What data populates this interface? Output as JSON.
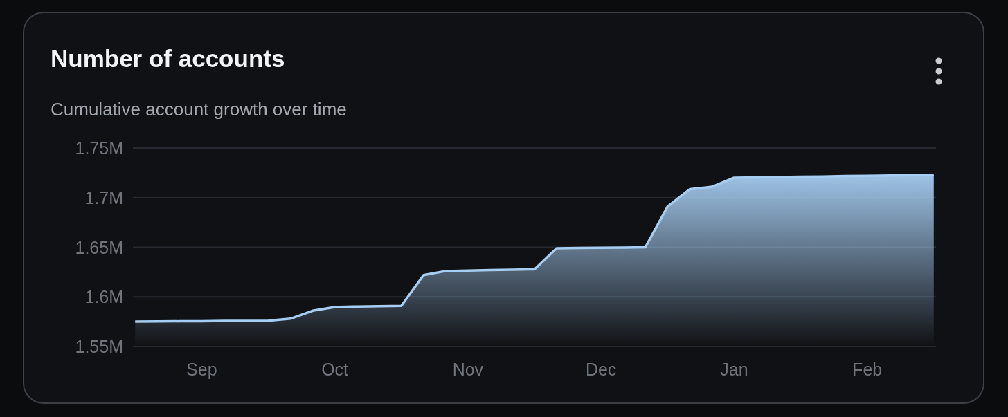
{
  "card": {
    "title": "Number of accounts",
    "subtitle": "Cumulative account growth over time",
    "chart_data": {
      "type": "area",
      "categories": [
        null,
        null,
        null,
        "Sep",
        null,
        null,
        null,
        null,
        null,
        "Oct",
        null,
        null,
        null,
        null,
        null,
        "Nov",
        null,
        null,
        null,
        null,
        null,
        "Dec",
        null,
        null,
        null,
        null,
        null,
        "Jan",
        null,
        null,
        null,
        null,
        null,
        "Feb",
        null,
        null,
        null
      ],
      "series": [
        {
          "color": "#a6cdf2",
          "values": [
            1.575,
            1.5752,
            1.5754,
            1.5755,
            1.5757,
            1.5758,
            1.576,
            1.578,
            1.586,
            1.5898,
            1.5903,
            1.5906,
            1.591,
            1.622,
            1.626,
            1.6265,
            1.627,
            1.6274,
            1.6278,
            1.649,
            1.6493,
            1.6495,
            1.6497,
            1.65,
            1.691,
            1.7085,
            1.711,
            1.7201,
            1.7204,
            1.7207,
            1.721,
            1.7213,
            1.7217,
            1.722,
            1.7223,
            1.7226,
            1.7229
          ]
        }
      ],
      "grid": true,
      "ylim": [
        1.55,
        1.75
      ],
      "yticks": [
        {
          "value": 1.55,
          "label": "1.55M"
        },
        {
          "value": 1.6,
          "label": "1.6M"
        },
        {
          "value": 1.65,
          "label": "1.65M"
        },
        {
          "value": 1.7,
          "label": "1.7M"
        },
        {
          "value": 1.75,
          "label": "1.75M"
        }
      ]
    }
  }
}
